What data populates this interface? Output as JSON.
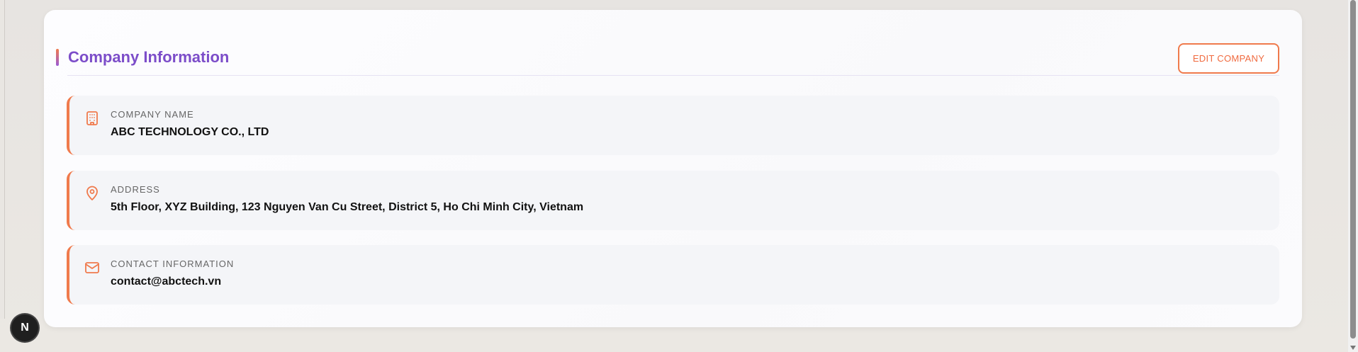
{
  "section": {
    "title": "Company Information",
    "edit_label": "EDIT COMPANY"
  },
  "rows": [
    {
      "icon": "building-icon",
      "label": "COMPANY NAME",
      "value": "ABC TECHNOLOGY CO., LTD"
    },
    {
      "icon": "location-pin-icon",
      "label": "ADDRESS",
      "value": "5th Floor, XYZ Building, 123 Nguyen Van Cu Street, District 5, Ho Chi Minh City, Vietnam"
    },
    {
      "icon": "mail-icon",
      "label": "CONTACT INFORMATION",
      "value": "contact@abctech.vn"
    }
  ],
  "badge": {
    "letter": "N"
  },
  "colors": {
    "accent": "#f07a4c",
    "title": "#7c4dc9"
  }
}
